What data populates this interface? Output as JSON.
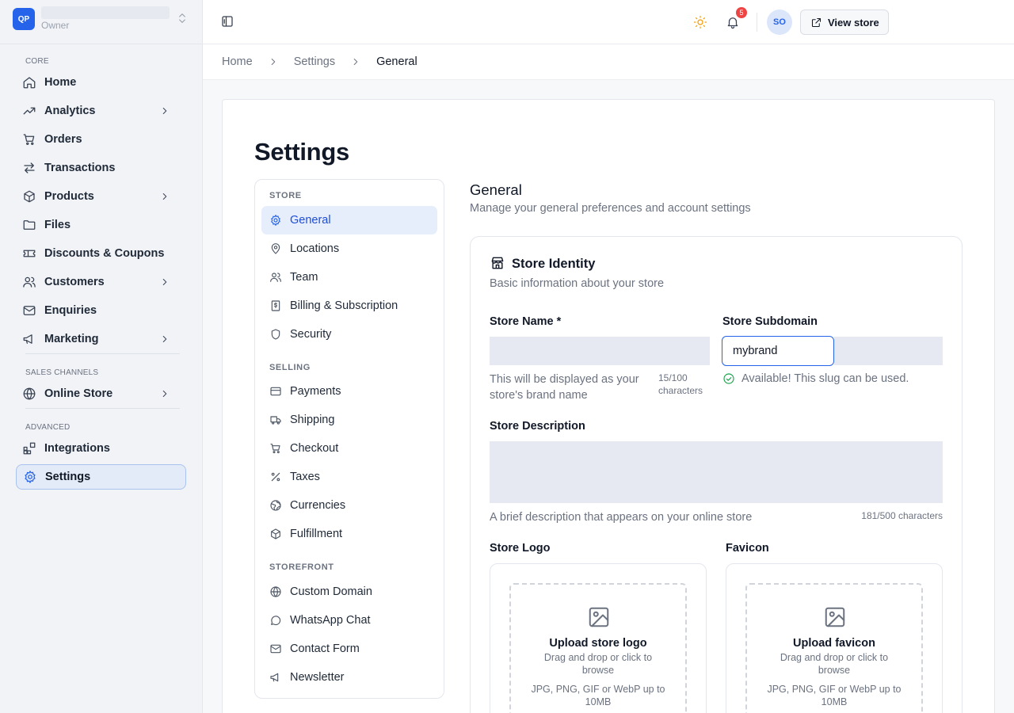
{
  "workspace": {
    "badge": "QP",
    "role": "Owner"
  },
  "sidebar": {
    "groups": {
      "core": "CORE",
      "sales": "SALES CHANNELS",
      "advanced": "ADVANCED"
    },
    "items": [
      {
        "label": "Home"
      },
      {
        "label": "Analytics"
      },
      {
        "label": "Orders"
      },
      {
        "label": "Transactions"
      },
      {
        "label": "Products"
      },
      {
        "label": "Files"
      },
      {
        "label": "Discounts & Coupons"
      },
      {
        "label": "Customers"
      },
      {
        "label": "Enquiries"
      },
      {
        "label": "Marketing"
      },
      {
        "label": "Online Store"
      },
      {
        "label": "Integrations"
      },
      {
        "label": "Settings",
        "active": true
      }
    ]
  },
  "topbar": {
    "view_store": "View store",
    "notifications": "5",
    "avatar": "SO"
  },
  "breadcrumb": [
    "Home",
    "Settings",
    "General"
  ],
  "page_title": "Settings",
  "settings_nav": {
    "groups": {
      "store": "STORE",
      "selling": "SELLING",
      "storefront": "STOREFRONT"
    },
    "items": [
      "General",
      "Locations",
      "Team",
      "Billing & Subscription",
      "Security",
      "Payments",
      "Shipping",
      "Checkout",
      "Taxes",
      "Currencies",
      "Fulfillment",
      "Custom Domain",
      "WhatsApp Chat",
      "Contact Form",
      "Newsletter"
    ]
  },
  "section": {
    "title": "General",
    "description": "Manage your general preferences and account settings"
  },
  "store_identity": {
    "title": "Store Identity",
    "description": "Basic information about your store",
    "store_name": {
      "label": "Store Name *",
      "help": "This will be displayed as your store's brand name",
      "count": "15/100 characters"
    },
    "subdomain": {
      "label": "Store Subdomain",
      "value": "mybrand",
      "status": "Available! This slug can be used."
    },
    "description_field": {
      "label": "Store Description",
      "help": "A brief description that appears on your online store",
      "count": "181/500 characters"
    },
    "logo": {
      "label": "Store Logo",
      "title": "Upload store logo",
      "sub": "Drag and drop or click to browse",
      "formats": "JPG, PNG, GIF or WebP up to 10MB"
    },
    "favicon": {
      "label": "Favicon",
      "title": "Upload favicon",
      "sub": "Drag and drop or click to browse",
      "formats": "JPG, PNG, GIF or WebP up to 10MB"
    }
  },
  "colors": {
    "accent": "#2563eb",
    "success": "#16a34a",
    "warning": "#f59e0b",
    "danger": "#ef4444"
  }
}
